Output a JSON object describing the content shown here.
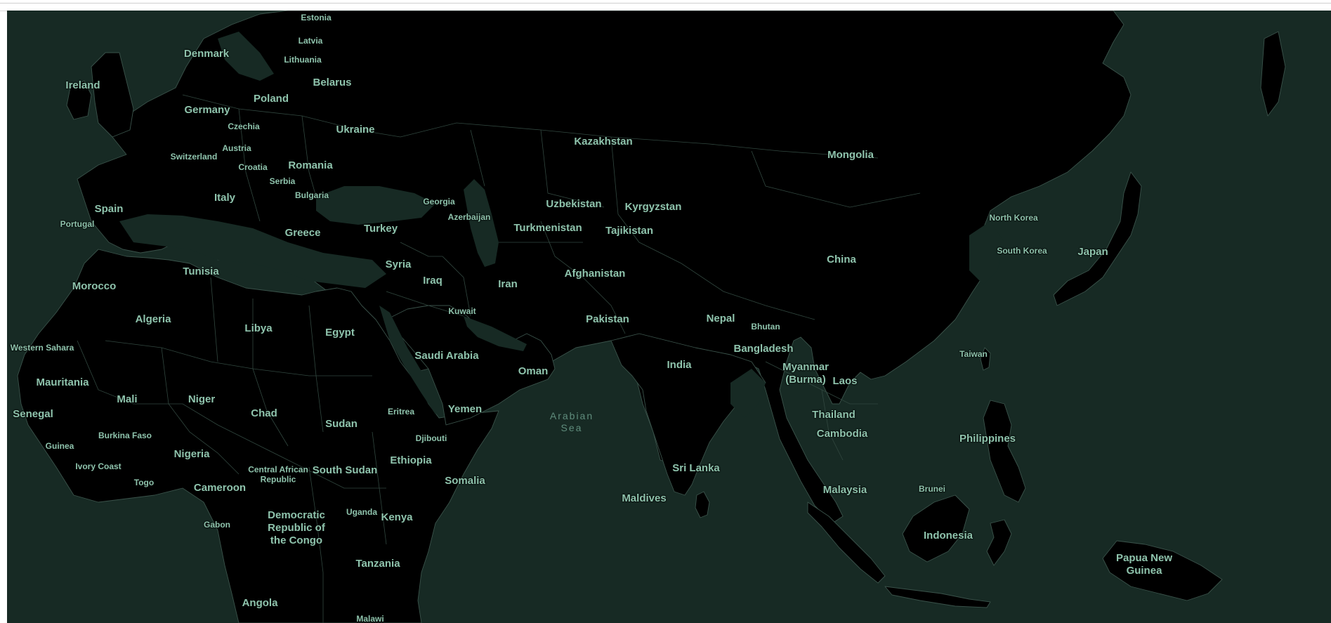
{
  "map": {
    "colors": {
      "land": "#000000",
      "water": "#172a24",
      "border": "#3a524a",
      "label": "#8fc4ad",
      "water_label": "#5f8c7c"
    },
    "countries": {
      "estonia": "Estonia",
      "latvia": "Latvia",
      "lithuania": "Lithuania",
      "denmark": "Denmark",
      "ireland": "Ireland",
      "belarus": "Belarus",
      "poland": "Poland",
      "germany": "Germany",
      "czechia": "Czechia",
      "ukraine": "Ukraine",
      "austria": "Austria",
      "switzerland": "Switzerland",
      "croatia": "Croatia",
      "romania": "Romania",
      "serbia": "Serbia",
      "bulgaria": "Bulgaria",
      "italy": "Italy",
      "spain": "Spain",
      "portugal": "Portugal",
      "greece": "Greece",
      "turkey": "Turkey",
      "georgia": "Georgia",
      "azerbaijan": "Azerbaijan",
      "kazakhstan": "Kazakhstan",
      "uzbekistan": "Uzbekistan",
      "kyrgyzstan": "Kyrgyzstan",
      "turkmenistan": "Turkmenistan",
      "tajikistan": "Tajikistan",
      "mongolia": "Mongolia",
      "north_korea": "North Korea",
      "south_korea": "South Korea",
      "japan": "Japan",
      "china": "China",
      "tunisia": "Tunisia",
      "morocco": "Morocco",
      "algeria": "Algeria",
      "libya": "Libya",
      "egypt": "Egypt",
      "syria": "Syria",
      "iraq": "Iraq",
      "iran": "Iran",
      "afghanistan": "Afghanistan",
      "kuwait": "Kuwait",
      "pakistan": "Pakistan",
      "nepal": "Nepal",
      "bhutan": "Bhutan",
      "bangladesh": "Bangladesh",
      "western_sahara": "Western Sahara",
      "saudi_arabia": "Saudi Arabia",
      "oman": "Oman",
      "india": "India",
      "myanmar": "Myanmar\n(Burma)",
      "laos": "Laos",
      "taiwan": "Taiwan",
      "mauritania": "Mauritania",
      "mali": "Mali",
      "niger": "Niger",
      "chad": "Chad",
      "sudan": "Sudan",
      "eritrea": "Eritrea",
      "yemen": "Yemen",
      "thailand": "Thailand",
      "senegal": "Senegal",
      "burkina_faso": "Burkina Faso",
      "djibouti": "Djibouti",
      "cambodia": "Cambodia",
      "philippines": "Philippines",
      "guinea": "Guinea",
      "nigeria": "Nigeria",
      "ethiopia": "Ethiopia",
      "ivory_coast": "Ivory Coast",
      "togo": "Togo",
      "central_african_republic": "Central African\nRepublic",
      "south_sudan": "South Sudan",
      "sri_lanka": "Sri Lanka",
      "somalia": "Somalia",
      "cameroon": "Cameroon",
      "malaysia": "Malaysia",
      "brunei": "Brunei",
      "maldives": "Maldives",
      "uganda": "Uganda",
      "democratic_republic_of_the_congo": "Democratic\nRepublic of\nthe Congo",
      "kenya": "Kenya",
      "gabon": "Gabon",
      "indonesia": "Indonesia",
      "papua_new_guinea": "Papua New\nGuinea",
      "tanzania": "Tanzania",
      "angola": "Angola",
      "malawi": "Malawi"
    },
    "water_bodies": {
      "arabian_sea": "Arabian\nSea"
    }
  }
}
